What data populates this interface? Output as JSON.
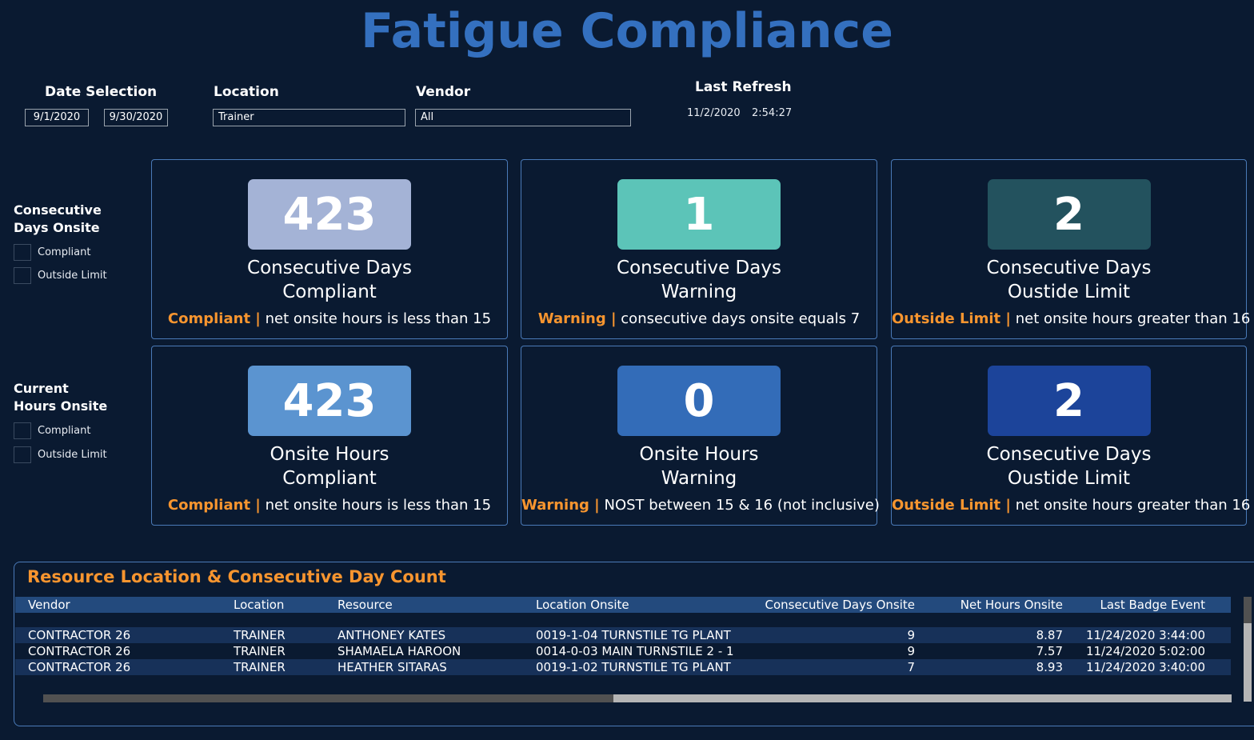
{
  "header": {
    "title": "Fatigue Compliance"
  },
  "filters": {
    "date_selection": {
      "label": "Date Selection",
      "start": "9/1/2020",
      "end": "9/30/2020"
    },
    "location": {
      "label": "Location",
      "value": "Trainer"
    },
    "vendor": {
      "label": "Vendor",
      "value": "All"
    },
    "last_refresh": {
      "label": "Last Refresh",
      "date": "11/2/2020",
      "time": "2:54:27"
    }
  },
  "slicers": [
    {
      "title_line1": "Consecutive",
      "title_line2": "Days Onsite",
      "options": [
        {
          "label": "Compliant",
          "checked": false
        },
        {
          "label": "Outside Limit",
          "checked": false
        }
      ]
    },
    {
      "title_line1": "Current",
      "title_line2": "Hours Onsite",
      "options": [
        {
          "label": "Compliant",
          "checked": false
        },
        {
          "label": "Outside Limit",
          "checked": false
        }
      ]
    }
  ],
  "cards": [
    {
      "value": "423",
      "color": "#a4b3d6",
      "title_line1": "Consecutive Days",
      "title_line2": "Compliant",
      "tag": "Compliant |",
      "desc": "net onsite hours is less than 15"
    },
    {
      "value": "1",
      "color": "#5cc4b8",
      "title_line1": "Consecutive Days",
      "title_line2": "Warning",
      "tag": "Warning |",
      "desc": "consecutive days onsite equals 7"
    },
    {
      "value": "2",
      "color": "#23525e",
      "title_line1": "Consecutive Days",
      "title_line2": "Oustide Limit",
      "tag": "Outside Limit |",
      "desc": "net onsite hours greater than 16"
    },
    {
      "value": "423",
      "color": "#5b94d0",
      "title_line1": "Onsite Hours",
      "title_line2": "Compliant",
      "tag": "Compliant |",
      "desc": "net onsite hours is less than 15"
    },
    {
      "value": "0",
      "color": "#336cb8",
      "title_line1": "Onsite Hours",
      "title_line2": "Warning",
      "tag": "Warning |",
      "desc": "NOST between 15 & 16 (not inclusive)"
    },
    {
      "value": "2",
      "color": "#1c449a",
      "title_line1": "Consecutive Days",
      "title_line2": "Oustide Limit",
      "tag": "Outside Limit |",
      "desc": "net onsite hours greater than 16"
    }
  ],
  "table": {
    "title": "Resource Location & Consecutive Day Count",
    "columns": [
      "Vendor",
      "Location",
      "Resource",
      "Location Onsite",
      "Consecutive Days Onsite",
      "Net Hours Onsite",
      "Last Badge Event"
    ],
    "rows": [
      [
        "CONTRACTOR 26",
        "TRAINER",
        "ANTHONEY KATES",
        "0019-1-04 TURNSTILE TG PLANT",
        "9",
        "8.87",
        "11/24/2020 3:44:00"
      ],
      [
        "CONTRACTOR 26",
        "TRAINER",
        "SHAMAELA HAROON",
        "0014-0-03 MAIN TURNSTILE 2 - 1",
        "9",
        "7.57",
        "11/24/2020 5:02:00"
      ],
      [
        "CONTRACTOR 26",
        "TRAINER",
        "HEATHER SITARAS",
        "0019-1-02 TURNSTILE TG PLANT",
        "7",
        "8.93",
        "11/24/2020 3:40:00"
      ]
    ],
    "horizontal_scroll_position": 0.48,
    "vertical_scroll_position": 0.0
  },
  "colors": {
    "background": "#0a1a31",
    "title": "#3470bf",
    "accent_orange": "#f7952f",
    "card_border": "#4a7ab8",
    "table_header": "#234a7d",
    "table_alt_row": "#173159"
  }
}
